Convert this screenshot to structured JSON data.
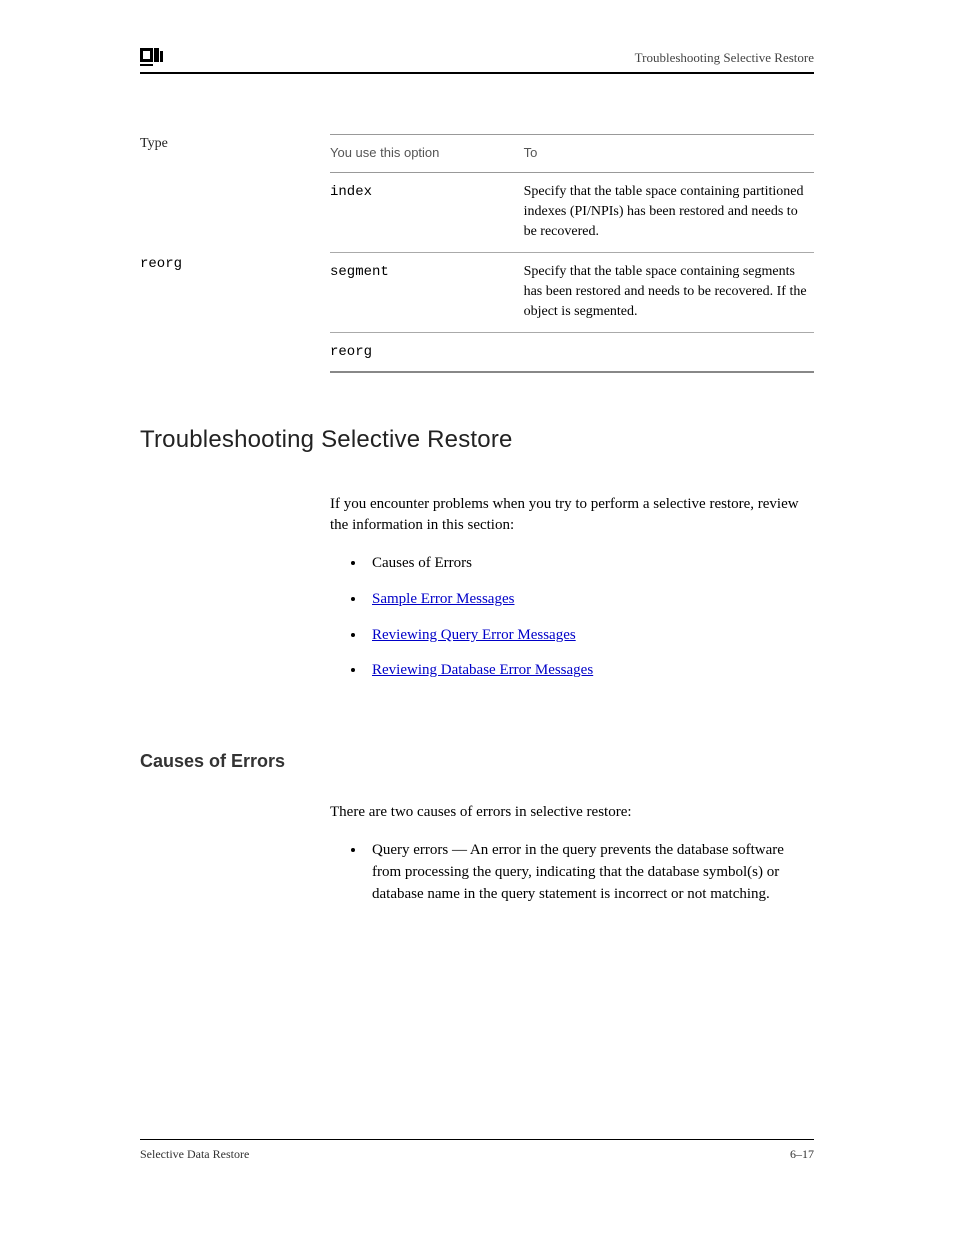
{
  "header": {
    "right": "Troubleshooting Selective Restore"
  },
  "left_label": "Type",
  "monospace_label": "reorg",
  "table": {
    "head": {
      "c1": "You use this option",
      "c2": "To"
    },
    "rows": [
      [
        "index",
        "Specify that the table space containing partitioned indexes (PI/NPIs) has been restored and needs to be recovered."
      ],
      [
        "segment",
        "Specify that the table space containing segments has been restored and needs to be recovered. If the object is segmented."
      ],
      [
        "reorg",
        ""
      ]
    ]
  },
  "section": {
    "title": "Troubleshooting Selective Restore",
    "intro": "If you encounter problems when you try to perform a selective restore, review the information in this section:",
    "bullets": [
      {
        "text": "Causes of Errors"
      },
      {
        "text": "Sample Error Messages",
        "link": true
      },
      {
        "text": "Reviewing Query Error Messages",
        "link": true
      },
      {
        "text": "Reviewing Database Error Messages",
        "link": true
      }
    ]
  },
  "subsection": {
    "title": "Causes of Errors",
    "para1": "There are two causes of errors in selective restore:",
    "bullets": [
      "Query errors — An error in the query prevents the database software from processing the query, indicating that the database symbol(s) or database name in the query statement is incorrect or not matching."
    ]
  },
  "footer": {
    "left": "Selective Data Restore",
    "right": "6–17"
  }
}
